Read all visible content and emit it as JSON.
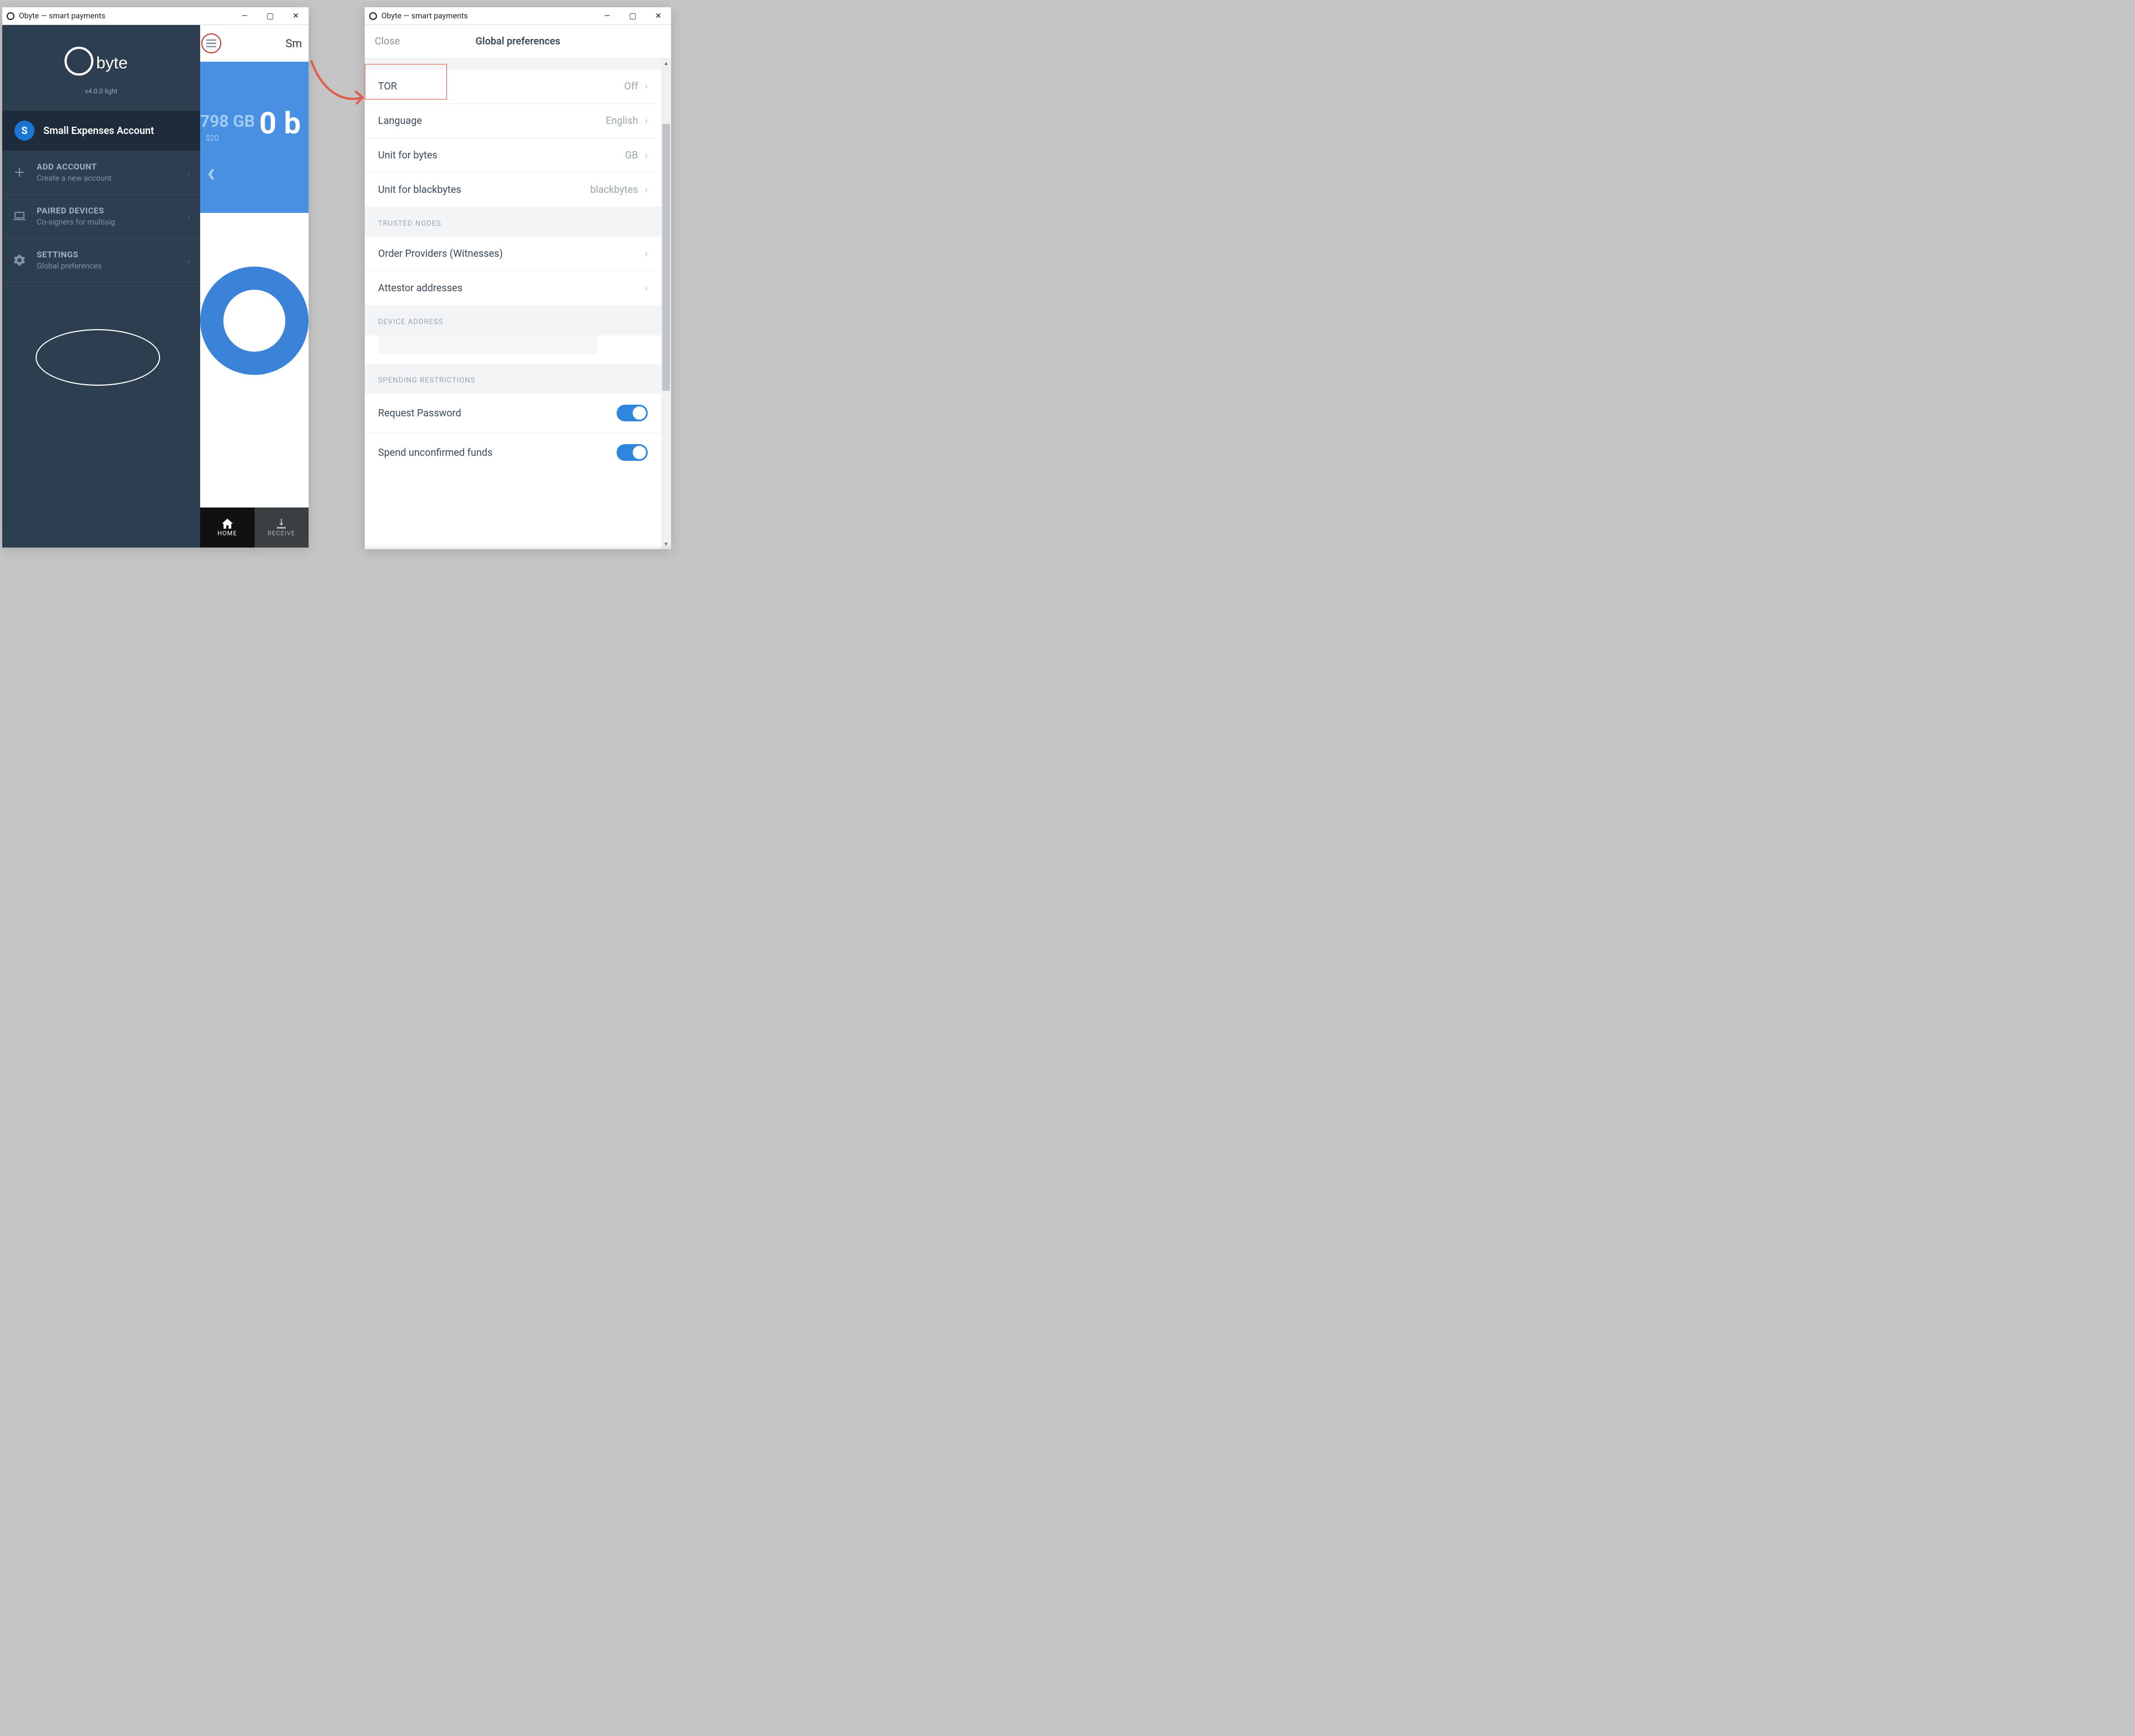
{
  "window1": {
    "title": "Obyte — smart payments",
    "logo_text": "byte",
    "version": "v4.0.0 light",
    "account": {
      "badge": "S",
      "name": "Small Expenses Account"
    },
    "menu": {
      "add_account": {
        "title": "ADD ACCOUNT",
        "subtitle": "Create a new account"
      },
      "paired_devices": {
        "title": "PAIRED DEVICES",
        "subtitle": "Co-signers for multisig"
      },
      "settings": {
        "title": "SETTINGS",
        "subtitle": "Global preferences"
      }
    },
    "peek": {
      "header_trail": "Sm",
      "hero_faded": "798 GB",
      "hero_faded_sub": "$20",
      "hero_balance": "0 b",
      "tabs": {
        "home": "HOME",
        "receive": "RECEIVE"
      }
    }
  },
  "window2": {
    "title": "Obyte — smart payments",
    "close": "Close",
    "header": "Global preferences",
    "rows": {
      "tor": {
        "label": "TOR",
        "value": "Off"
      },
      "language": {
        "label": "Language",
        "value": "English"
      },
      "unit_bytes": {
        "label": "Unit for bytes",
        "value": "GB"
      },
      "unit_blackbytes": {
        "label": "Unit for blackbytes",
        "value": "blackbytes"
      },
      "order_providers": "Order Providers (Witnesses)",
      "attestor": "Attestor addresses",
      "request_password": "Request Password",
      "spend_unconfirmed": "Spend unconfirmed funds"
    },
    "sections": {
      "trusted_nodes": "TRUSTED NODES",
      "device_address": "DEVICE ADDRESS",
      "spending_restrictions": "SPENDING RESTRICTIONS"
    }
  }
}
